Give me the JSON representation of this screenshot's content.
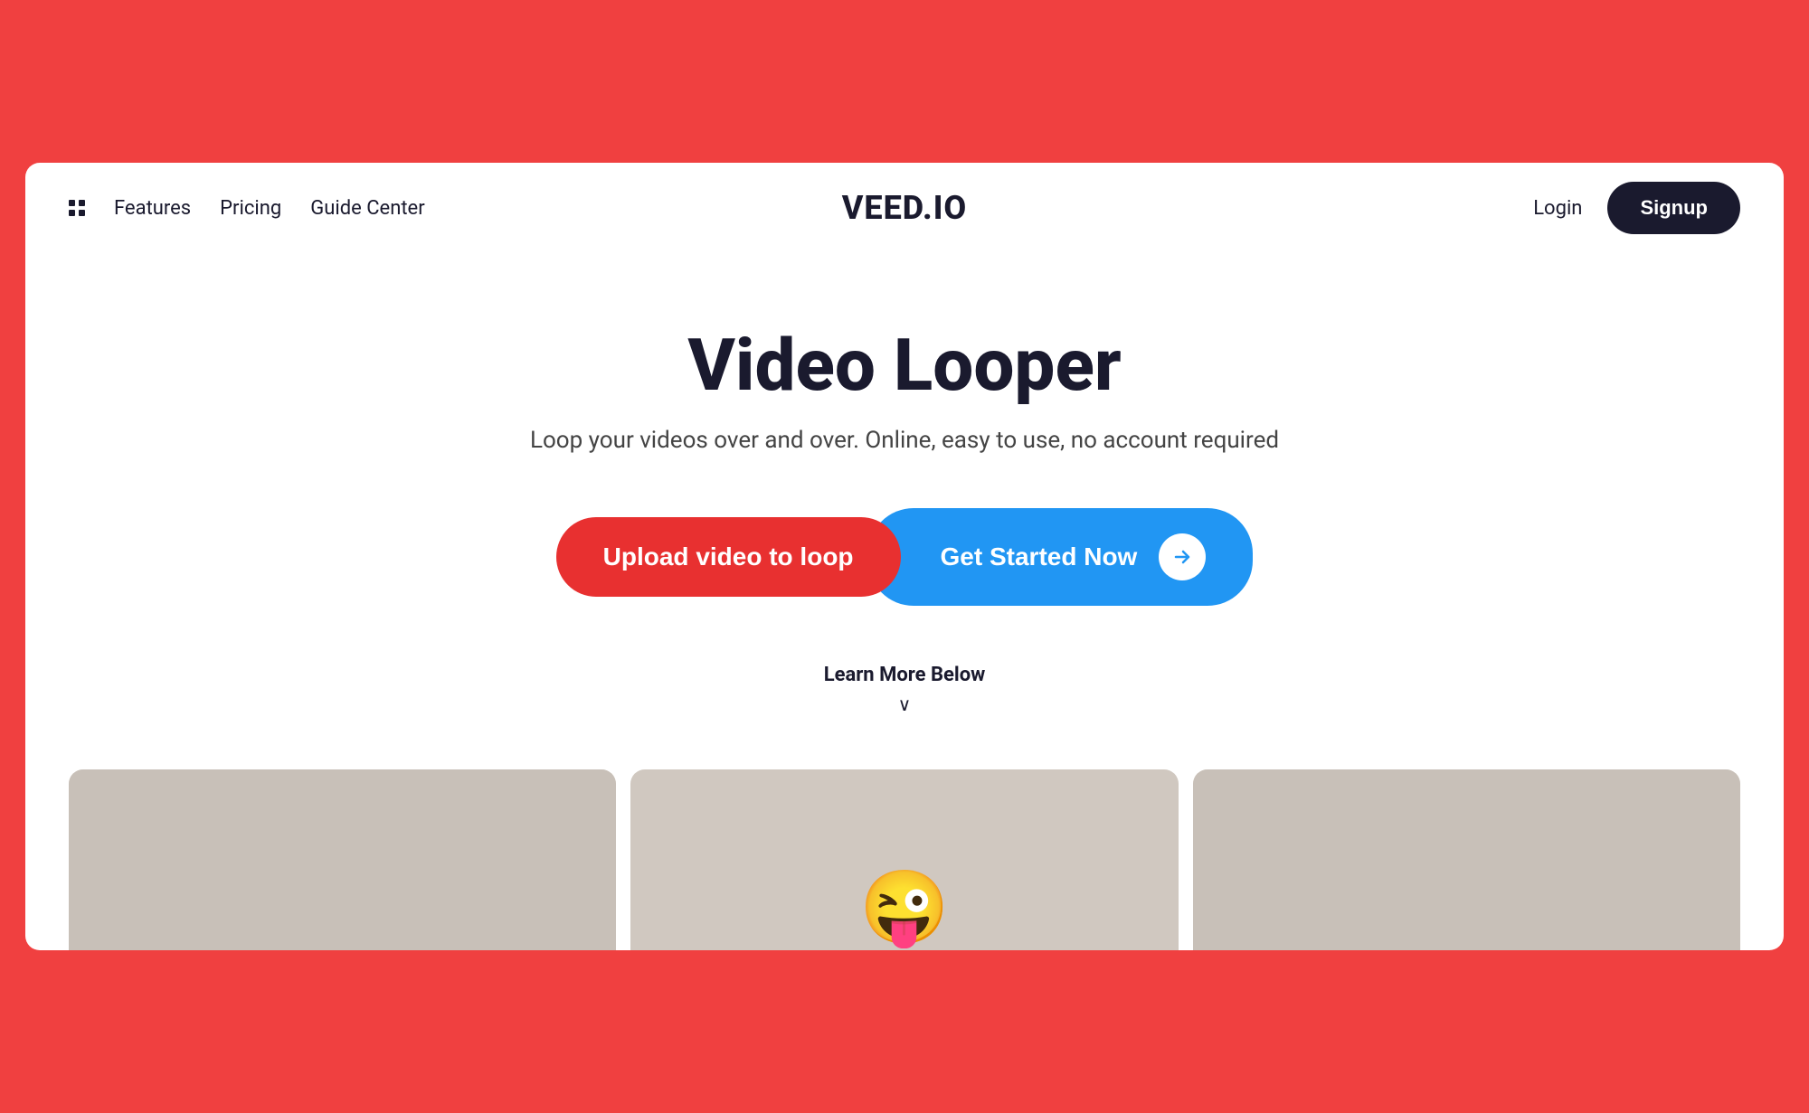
{
  "colors": {
    "brand_dark": "#1a1a2e",
    "red_accent": "#f04040",
    "button_red": "#e83030",
    "button_blue": "#2196f3",
    "white": "#ffffff"
  },
  "navbar": {
    "logo": "VEED.IO",
    "features_label": "Features",
    "pricing_label": "Pricing",
    "guide_center_label": "Guide Center",
    "login_label": "Login",
    "signup_label": "Signup"
  },
  "hero": {
    "title": "Video Looper",
    "subtitle": "Loop your videos over and over. Online, easy to use, no account required",
    "upload_button_label": "Upload video to loop",
    "get_started_label": "Get Started Now",
    "learn_more_label": "Learn More Below",
    "chevron": "∨"
  },
  "preview": {
    "cards": [
      {
        "id": "card-left",
        "has_emoji": false
      },
      {
        "id": "card-center",
        "has_emoji": true,
        "emoji": "😜"
      },
      {
        "id": "card-right",
        "has_emoji": false
      }
    ]
  }
}
